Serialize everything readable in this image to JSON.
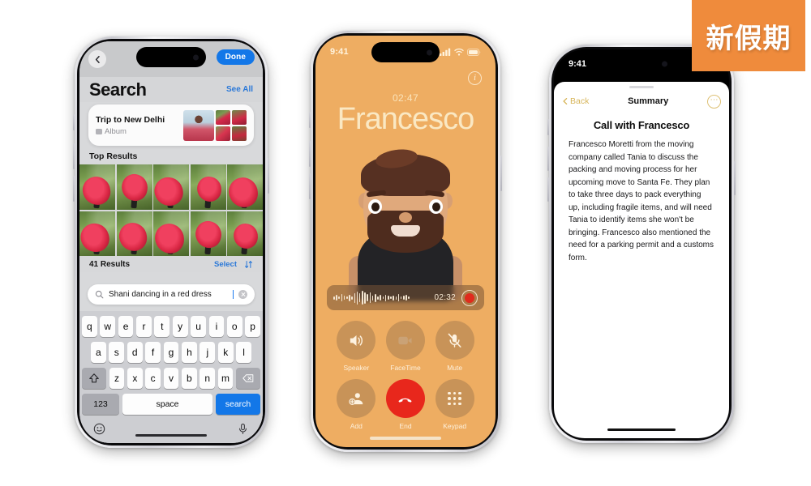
{
  "watermark": {
    "text": "新假期",
    "bg_color": "#ef8b3c"
  },
  "phone1": {
    "name": "photos-search-screen",
    "nav": {
      "back_icon": "chevron-left-icon",
      "done_label": "Done"
    },
    "header": {
      "title": "Search",
      "see_all_label": "See All"
    },
    "album_card": {
      "title": "Trip to New Delhi",
      "subtitle": "Album",
      "icon": "album-book-icon"
    },
    "top_results_label": "Top Results",
    "results_bar": {
      "count_label": "41 Results",
      "select_label": "Select",
      "sort_icon": "sort-arrows-icon"
    },
    "search": {
      "value": "Shani dancing in a red dress",
      "placeholder": "Search",
      "icon": "search-icon",
      "clear_icon": "clear-circle-icon"
    },
    "keyboard": {
      "row1": [
        "q",
        "w",
        "e",
        "r",
        "t",
        "y",
        "u",
        "i",
        "o",
        "p"
      ],
      "row2": [
        "a",
        "s",
        "d",
        "f",
        "g",
        "h",
        "j",
        "k",
        "l"
      ],
      "row3": [
        "z",
        "x",
        "c",
        "v",
        "b",
        "n",
        "m"
      ],
      "shift_icon": "shift-up-icon",
      "delete_icon": "backspace-icon",
      "numbers_label": "123",
      "space_label": "space",
      "enter_label": "search",
      "emoji_icon": "emoji-smiley-icon",
      "dictation_icon": "microphone-icon"
    }
  },
  "phone2": {
    "name": "active-call-screen",
    "status": {
      "time": "9:41",
      "cellular_icon": "cellular-bars-icon",
      "wifi_icon": "wifi-icon",
      "battery_icon": "battery-icon"
    },
    "info_button": "info-circle-icon",
    "call_duration": "02:47",
    "caller_name": "Francesco",
    "avatar": "memoji-avatar",
    "recording": {
      "timer": "02:32",
      "record_icon": "record-stop-icon",
      "waveform_icon": "audio-waveform-icon"
    },
    "controls": [
      {
        "label": "Speaker",
        "icon": "speaker-wave-icon"
      },
      {
        "label": "FaceTime",
        "icon": "facetime-video-icon"
      },
      {
        "label": "Mute",
        "icon": "microphone-slash-icon"
      },
      {
        "label": "Add",
        "icon": "add-person-icon"
      },
      {
        "label": "End",
        "icon": "end-call-icon"
      },
      {
        "label": "Keypad",
        "icon": "keypad-dots-icon"
      }
    ],
    "bg_color": "#eead62",
    "end_color": "#e8271c"
  },
  "phone3": {
    "name": "call-summary-screen",
    "status": {
      "time": "9:41"
    },
    "nav": {
      "back_label": "Back",
      "back_icon": "chevron-left-icon",
      "title": "Summary",
      "more_icon": "more-ellipsis-icon"
    },
    "heading": "Call with Francesco",
    "body": "Francesco Moretti from the moving company called Tania to discuss the packing and moving process for her upcoming move to Santa Fe. They plan to take three days to pack everything up, including fragile items, and will need Tania to identify items she won't be bringing. Francesco also mentioned the need for a parking permit and a customs form.",
    "accent_color": "#d7b55a"
  }
}
